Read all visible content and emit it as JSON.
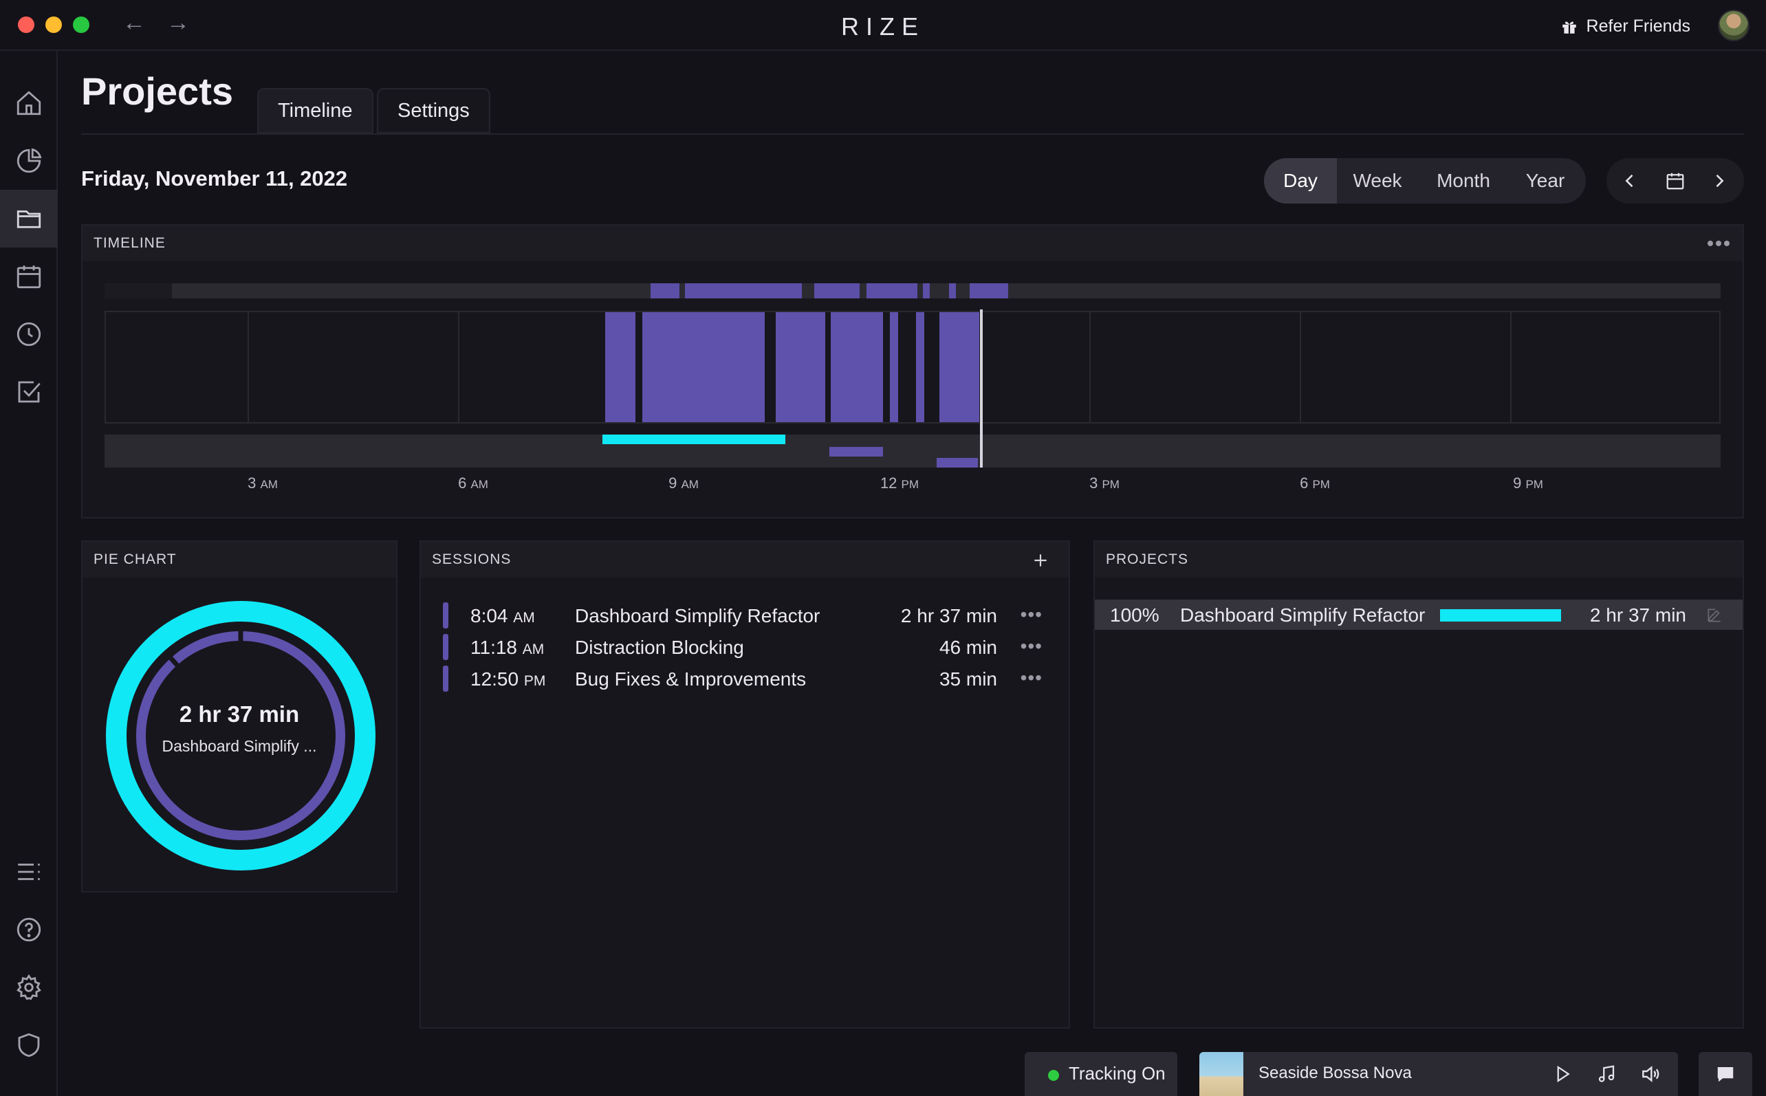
{
  "window": {
    "logo": "RIZE",
    "refer_label": "Refer Friends",
    "back_arrow": "←",
    "forward_arrow": "→"
  },
  "sidebar": {
    "items": [
      {
        "name": "home",
        "icon": "home-icon",
        "active": false
      },
      {
        "name": "analytics",
        "icon": "pie-chart-icon",
        "active": false
      },
      {
        "name": "projects",
        "icon": "folder-icon",
        "active": true
      },
      {
        "name": "calendar",
        "icon": "calendar-icon",
        "active": false
      },
      {
        "name": "history",
        "icon": "clock-icon",
        "active": false
      },
      {
        "name": "tasks",
        "icon": "checkbox-icon",
        "active": false
      }
    ],
    "bottom_items": [
      {
        "name": "list",
        "icon": "list-icon"
      },
      {
        "name": "help",
        "icon": "help-icon"
      },
      {
        "name": "settings",
        "icon": "gear-icon"
      },
      {
        "name": "privacy",
        "icon": "shield-icon"
      }
    ]
  },
  "header": {
    "title": "Projects",
    "tabs": [
      {
        "label": "Timeline"
      },
      {
        "label": "Settings"
      }
    ],
    "date": "Friday, November 11, 2022",
    "ranges": [
      {
        "label": "Day",
        "active": true
      },
      {
        "label": "Week",
        "active": false
      },
      {
        "label": "Month",
        "active": false
      },
      {
        "label": "Year",
        "active": false
      }
    ]
  },
  "timeline": {
    "title": "TIMELINE",
    "ticks": [
      {
        "num": "3",
        "ampm": "AM"
      },
      {
        "num": "6",
        "ampm": "AM"
      },
      {
        "num": "9",
        "ampm": "AM"
      },
      {
        "num": "12",
        "ampm": "PM"
      },
      {
        "num": "3",
        "ampm": "PM"
      },
      {
        "num": "6",
        "ampm": "PM"
      },
      {
        "num": "9",
        "ampm": "PM"
      }
    ]
  },
  "pie": {
    "title": "PIE CHART",
    "center_value": "2 hr 37 min",
    "center_label": "Dashboard Simplify ...",
    "outer_color": "#11e8f5",
    "inner_color": "#5f52ad"
  },
  "sessions": {
    "title": "SESSIONS",
    "rows": [
      {
        "time": "8:04",
        "ampm": "AM",
        "name": "Dashboard Simplify Refactor",
        "duration": "2 hr 37 min"
      },
      {
        "time": "11:18",
        "ampm": "AM",
        "name": "Distraction Blocking",
        "duration": "46 min"
      },
      {
        "time": "12:50",
        "ampm": "PM",
        "name": "Bug Fixes & Improvements",
        "duration": "35 min"
      }
    ]
  },
  "projects": {
    "title": "PROJECTS",
    "rows": [
      {
        "percent_label": "100%",
        "share": 1.0,
        "name": "Dashboard Simplify Refactor",
        "duration": "2 hr 37 min"
      }
    ]
  },
  "bottom_bar": {
    "tracking_label": "Tracking On",
    "track_name": "Seaside Bossa Nova"
  },
  "colors": {
    "accent": "#5f52ad",
    "cyan": "#11e8f5",
    "tracking": "#2ecc40",
    "background": "#141219"
  }
}
